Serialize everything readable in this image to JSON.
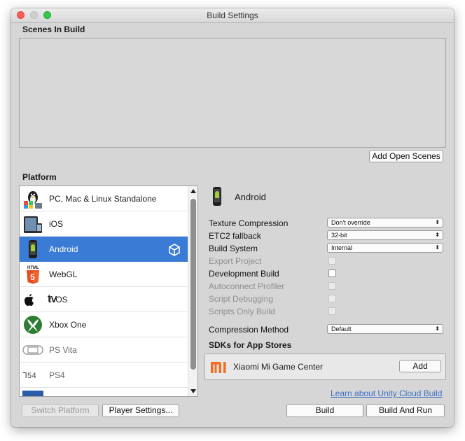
{
  "window": {
    "title": "Build Settings"
  },
  "scenes": {
    "header": "Scenes In Build",
    "add_open_scenes": "Add Open Scenes"
  },
  "platform": {
    "header": "Platform",
    "items": [
      {
        "label": "PC, Mac & Linux Standalone",
        "icon": "pc-mac-linux-icon"
      },
      {
        "label": "iOS",
        "icon": "ios-icon"
      },
      {
        "label": "Android",
        "icon": "android-icon",
        "selected": true
      },
      {
        "label": "WebGL",
        "icon": "webgl-html5-icon"
      },
      {
        "label": "tvOS",
        "icon": "tvos-icon"
      },
      {
        "label": "Xbox One",
        "icon": "xbox-icon"
      },
      {
        "label": "PS Vita",
        "icon": "ps-vita-icon"
      },
      {
        "label": "PS4",
        "icon": "ps4-icon"
      }
    ]
  },
  "selected_platform": {
    "name": "Android"
  },
  "settings": {
    "texture_compression": {
      "label": "Texture Compression",
      "value": "Don't override"
    },
    "etc2_fallback": {
      "label": "ETC2 fallback",
      "value": "32-bit"
    },
    "build_system": {
      "label": "Build System",
      "value": "Internal"
    },
    "export_project": {
      "label": "Export Project"
    },
    "development_build": {
      "label": "Development Build"
    },
    "autoconnect_profiler": {
      "label": "Autoconnect Profiler"
    },
    "script_debugging": {
      "label": "Script Debugging"
    },
    "scripts_only_build": {
      "label": "Scripts Only Build"
    },
    "compression_method": {
      "label": "Compression Method",
      "value": "Default"
    }
  },
  "sdks": {
    "header": "SDKs for App Stores",
    "items": [
      {
        "name": "Xiaomi Mi Game Center",
        "action": "Add"
      }
    ]
  },
  "footer": {
    "learn_link": "Learn about Unity Cloud Build",
    "switch_platform": "Switch Platform",
    "player_settings": "Player Settings...",
    "build": "Build",
    "build_and_run": "Build And Run"
  },
  "colors": {
    "selection": "#3a7bd5",
    "link": "#3a6fc4",
    "xiaomi": "#f26d1f",
    "xbox": "#2e7d32",
    "html5": "#e44d26"
  }
}
